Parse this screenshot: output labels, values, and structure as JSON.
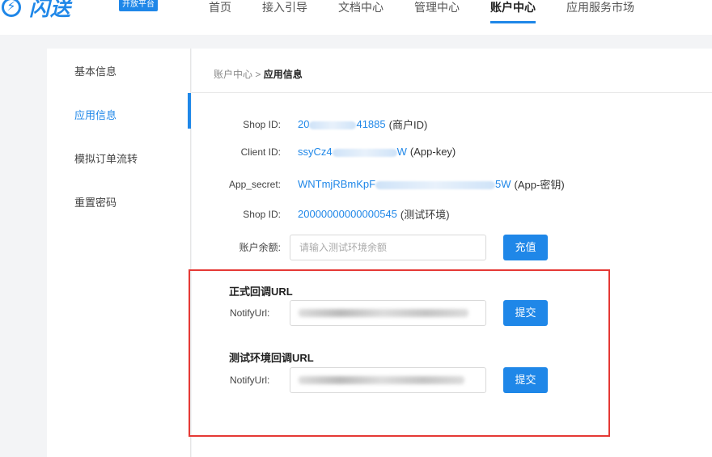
{
  "brand": {
    "logo_glyph": "⚡",
    "name": "闪送",
    "badge": "开放平台",
    "color": "#1f87e8"
  },
  "nav": {
    "items": [
      "首页",
      "接入引导",
      "文档中心",
      "管理中心",
      "账户中心",
      "应用服务市场"
    ],
    "active": "账户中心"
  },
  "sidebar": {
    "items": [
      "基本信息",
      "应用信息",
      "模拟订单流转",
      "重置密码"
    ],
    "active": "应用信息"
  },
  "breadcrumb": {
    "parent": "账户中心 >",
    "current": "应用信息"
  },
  "info": {
    "shop_id_label": "Shop ID:",
    "shop_id_value_start": "20",
    "shop_id_value_end": "41885",
    "shop_id_note": "(商户ID)",
    "client_id_label": "Client ID:",
    "client_id_value_start": "ssyCz4",
    "client_id_value_end": "W",
    "client_id_note": "(App-key)",
    "app_secret_label": "App_secret:",
    "app_secret_value_start": "WNTmjRBmKpF",
    "app_secret_value_end": "5W",
    "app_secret_note": "(App-密钥)",
    "test_shop_id_label": "Shop ID:",
    "test_shop_id_value": "20000000000000545",
    "test_shop_id_note": "(测试环境)"
  },
  "balance": {
    "label": "账户余额:",
    "placeholder": "请输入测试环境余额",
    "button": "充值"
  },
  "callback_prod": {
    "title": "正式回调URL",
    "label": "NotifyUrl:",
    "button": "提交"
  },
  "callback_test": {
    "title": "测试环境回调URL",
    "label": "NotifyUrl:",
    "button": "提交"
  }
}
